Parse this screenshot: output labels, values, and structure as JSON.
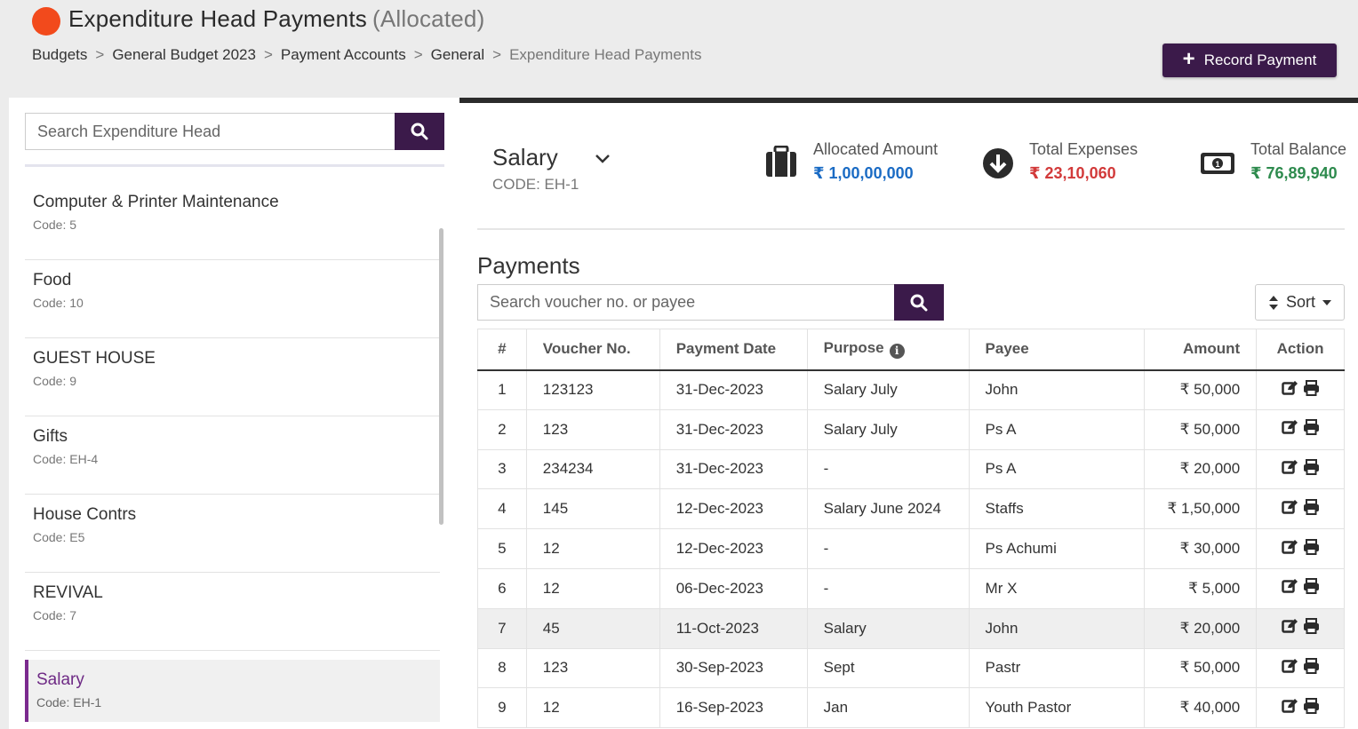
{
  "header": {
    "title": "Expenditure Head Payments",
    "subtitle": "(Allocated)",
    "breadcrumbs": [
      "Budgets",
      "General Budget 2023",
      "Payment Accounts",
      "General",
      "Expenditure Head Payments"
    ],
    "record_button": "Record Payment",
    "accent_color": "#3b1a4a",
    "logo_color": "#f24a1c"
  },
  "sidebar": {
    "search_placeholder": "Search Expenditure Head",
    "items": [
      {
        "name": "Computer & Printer Maintenance",
        "code": "Code: 5"
      },
      {
        "name": "Food",
        "code": "Code: 10"
      },
      {
        "name": "GUEST HOUSE",
        "code": "Code: 9"
      },
      {
        "name": "Gifts",
        "code": "Code: EH-4"
      },
      {
        "name": "House Contrs",
        "code": "Code: E5"
      },
      {
        "name": "REVIVAL",
        "code": "Code: 7"
      },
      {
        "name": "Salary",
        "code": "Code: EH-1"
      }
    ]
  },
  "summary": {
    "head_name": "Salary",
    "head_code": "CODE: EH-1",
    "allocated_label": "Allocated Amount",
    "allocated_value": "₹ 1,00,00,000",
    "expenses_label": "Total Expenses",
    "expenses_value": "₹ 23,10,060",
    "balance_label": "Total Balance",
    "balance_value": "₹ 76,89,940",
    "colors": {
      "allocated": "#1a6bc4",
      "expenses": "#d23a3a",
      "balance": "#2e8b4e"
    }
  },
  "payments": {
    "title": "Payments",
    "search_placeholder": "Search voucher no. or payee",
    "sort_label": "Sort",
    "columns": [
      "#",
      "Voucher No.",
      "Payment Date",
      "Purpose",
      "Payee",
      "Amount",
      "Action"
    ],
    "rows": [
      {
        "n": "1",
        "voucher": "123123",
        "date": "31-Dec-2023",
        "purpose": "Salary July",
        "payee": "John",
        "amount": "₹ 50,000"
      },
      {
        "n": "2",
        "voucher": "123",
        "date": "31-Dec-2023",
        "purpose": "Salary July",
        "payee": "Ps A",
        "amount": "₹ 50,000"
      },
      {
        "n": "3",
        "voucher": "234234",
        "date": "31-Dec-2023",
        "purpose": "-",
        "payee": "Ps A",
        "amount": "₹ 20,000"
      },
      {
        "n": "4",
        "voucher": "145",
        "date": "12-Dec-2023",
        "purpose": "Salary June 2024",
        "payee": "Staffs",
        "amount": "₹ 1,50,000"
      },
      {
        "n": "5",
        "voucher": "12",
        "date": "12-Dec-2023",
        "purpose": "-",
        "payee": "Ps Achumi",
        "amount": "₹ 30,000"
      },
      {
        "n": "6",
        "voucher": "12",
        "date": "06-Dec-2023",
        "purpose": "-",
        "payee": "Mr X",
        "amount": "₹ 5,000"
      },
      {
        "n": "7",
        "voucher": "45",
        "date": "11-Oct-2023",
        "purpose": "Salary",
        "payee": "John",
        "amount": "₹ 20,000"
      },
      {
        "n": "8",
        "voucher": "123",
        "date": "30-Sep-2023",
        "purpose": "Sept",
        "payee": "Pastr",
        "amount": "₹ 50,000"
      },
      {
        "n": "9",
        "voucher": "12",
        "date": "16-Sep-2023",
        "purpose": "Jan",
        "payee": "Youth Pastor",
        "amount": "₹ 40,000"
      }
    ]
  }
}
